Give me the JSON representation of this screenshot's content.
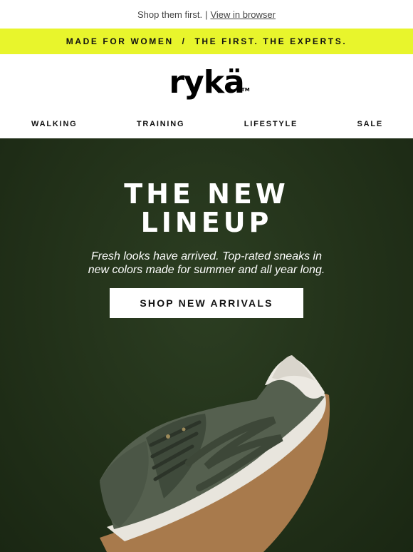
{
  "preheader": {
    "text": "Shop them first.",
    "separator": "|",
    "link": "View in browser"
  },
  "promo": {
    "text": "MADE FOR WOMEN  /  THE FIRST. THE EXPERTS.",
    "bg_color": "#e8f52c"
  },
  "brand": {
    "logo": "rykä",
    "tm": "TM"
  },
  "nav": {
    "items": [
      "WALKING",
      "TRAINING",
      "LIFESTYLE",
      "SALE"
    ]
  },
  "hero": {
    "title_line1": "THE NEW",
    "title_line2": "LINEUP",
    "subtitle_line1": "Fresh looks have arrived. Top-rated sneaks in",
    "subtitle_line2": "new colors made for summer and all year long.",
    "cta": "SHOP NEW ARRIVALS",
    "bg_color": "#223119",
    "product_icon": "sneaker-image"
  }
}
